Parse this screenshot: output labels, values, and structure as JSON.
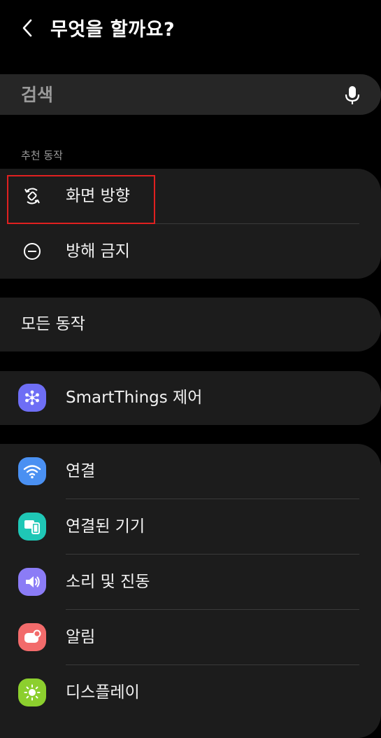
{
  "header": {
    "title": "무엇을 할까요?"
  },
  "search": {
    "placeholder": "검색"
  },
  "recommended": {
    "label": "추천 동작",
    "items": [
      {
        "label": "화면 방향",
        "icon": "rotate-icon"
      },
      {
        "label": "방해 금지",
        "icon": "do-not-disturb-icon"
      }
    ]
  },
  "all_actions": {
    "label": "모든 동작"
  },
  "smartthings": {
    "label": "SmartThings 제어",
    "icon": "smartthings-icon",
    "color": "#6e6ef5"
  },
  "settings": {
    "items": [
      {
        "label": "연결",
        "icon": "wifi-icon",
        "color": "#4a90f2"
      },
      {
        "label": "연결된 기기",
        "icon": "devices-icon",
        "color": "#1fc7b6"
      },
      {
        "label": "소리 및 진동",
        "icon": "volume-icon",
        "color": "#8b7cf6"
      },
      {
        "label": "알림",
        "icon": "notification-icon",
        "color": "#f26b6b"
      },
      {
        "label": "디스플레이",
        "icon": "display-icon",
        "color": "#8ccf2e"
      }
    ]
  }
}
